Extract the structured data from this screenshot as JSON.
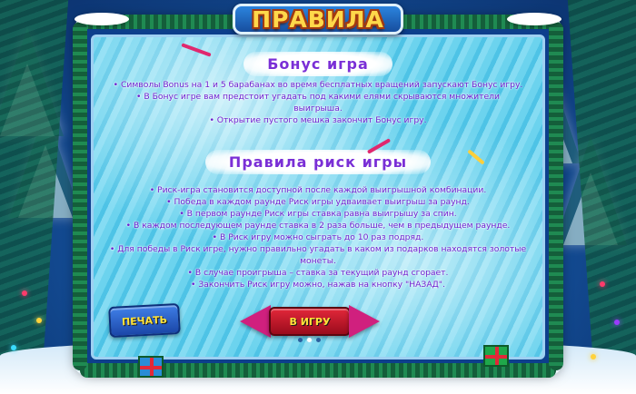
{
  "title": "ПРАВИЛА",
  "bonus_section": {
    "heading": "Бонус игра",
    "lines": [
      "• Символы Bonus на 1 и 5 барабанах во время бесплатных вращений запускают Бонус игру.",
      "• В Бонус игре вам предстоит угадать под какими елями скрываются множители",
      "выигрыша.",
      "• Открытие пустого мешка закончит Бонус игру."
    ]
  },
  "risk_section": {
    "heading": "Правила риск игры",
    "lines": [
      "• Риск-игра становится доступной после каждой выигрышной комбинации.",
      "• Победа в каждом раунде Риск игры удваивает выигрыш за раунд.",
      "• В первом раунде Риск игры ставка равна выигрышу за спин.",
      "• В каждом последующем раунде ставка в 2 раза больше, чем в предыдущем раунде.",
      "• В Риск игру можно сыграть до 10 раз подряд.",
      "• Для победы в Риск игре, нужно правильно угадать в каком из подарков находятся золотые",
      "монеты.",
      "• В случае проигрыша – ставка за текущий раунд сгорает.",
      "• Закончить Риск игру можно, нажав на кнопку \"НАЗАД\"."
    ]
  },
  "buttons": {
    "print": "ПЕЧАТЬ",
    "play": "В ИГРУ"
  },
  "pagination": {
    "pages": 3,
    "current": 2
  },
  "icons": {
    "prev": "arrow-left-icon",
    "next": "arrow-right-icon"
  },
  "colors": {
    "text": "#6e1fd0",
    "heading": "#7a2fd6",
    "title": "#ffd84a",
    "arrow": "#d0207e",
    "play_button": "#e2283a",
    "print_button": "#3f7ee6"
  }
}
